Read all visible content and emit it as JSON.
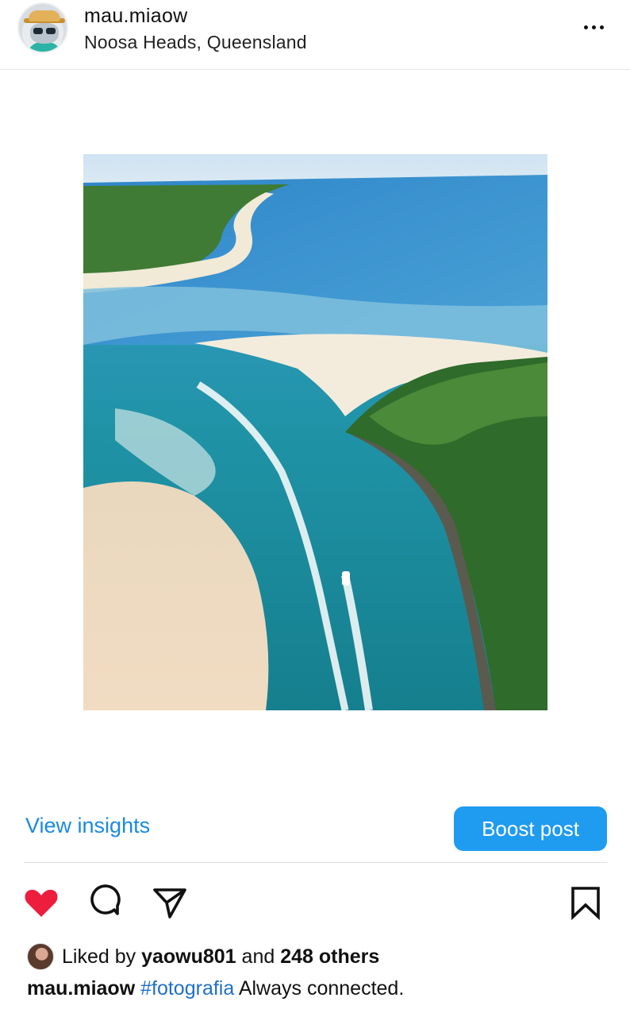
{
  "post": {
    "username": "mau.miaow",
    "location": "Noosa Heads, Queensland",
    "more_icon": "more-horizontal-icon",
    "image_description_icon": "photo"
  },
  "actions_bar": {
    "view_insights": "View insights",
    "boost_post": "Boost post",
    "boost_color": "#1f9bf0",
    "link_color": "#1a8ae0",
    "like_icon": "heart-filled-icon",
    "like_color": "#ee1d3e",
    "comment_icon": "comment-icon",
    "share_icon": "send-icon",
    "save_icon": "bookmark-icon"
  },
  "likes": {
    "prefix": "Liked by",
    "user": "yaowu801",
    "joiner": "and",
    "others": "248 others"
  },
  "caption": {
    "user": "mau.miaow",
    "hashtag": "#fotografia",
    "text": "Always connected."
  }
}
